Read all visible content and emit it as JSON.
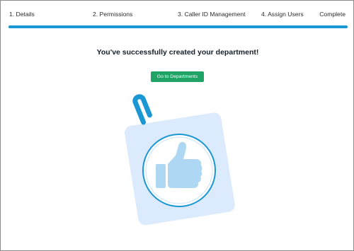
{
  "wizard": {
    "steps": [
      {
        "label": "1. Details"
      },
      {
        "label": "2. Permissions"
      },
      {
        "label": "3. Caller ID Management"
      },
      {
        "label": "4. Assign Users"
      },
      {
        "label": "Complete"
      }
    ],
    "progress_fraction": 1.0
  },
  "main": {
    "title": "You've successfully created your department!",
    "primary_button_label": "Go to Departments"
  },
  "illustration": {
    "icons": [
      "paperclip-icon",
      "thumbs-up-icon"
    ],
    "colors": {
      "card": "#dbeafc",
      "clip": "#1b97d4",
      "ring": "#1b97d4",
      "thumb": "#aed7f4"
    }
  },
  "colors": {
    "progress": "#1b97d4",
    "button": "#1fa466"
  }
}
